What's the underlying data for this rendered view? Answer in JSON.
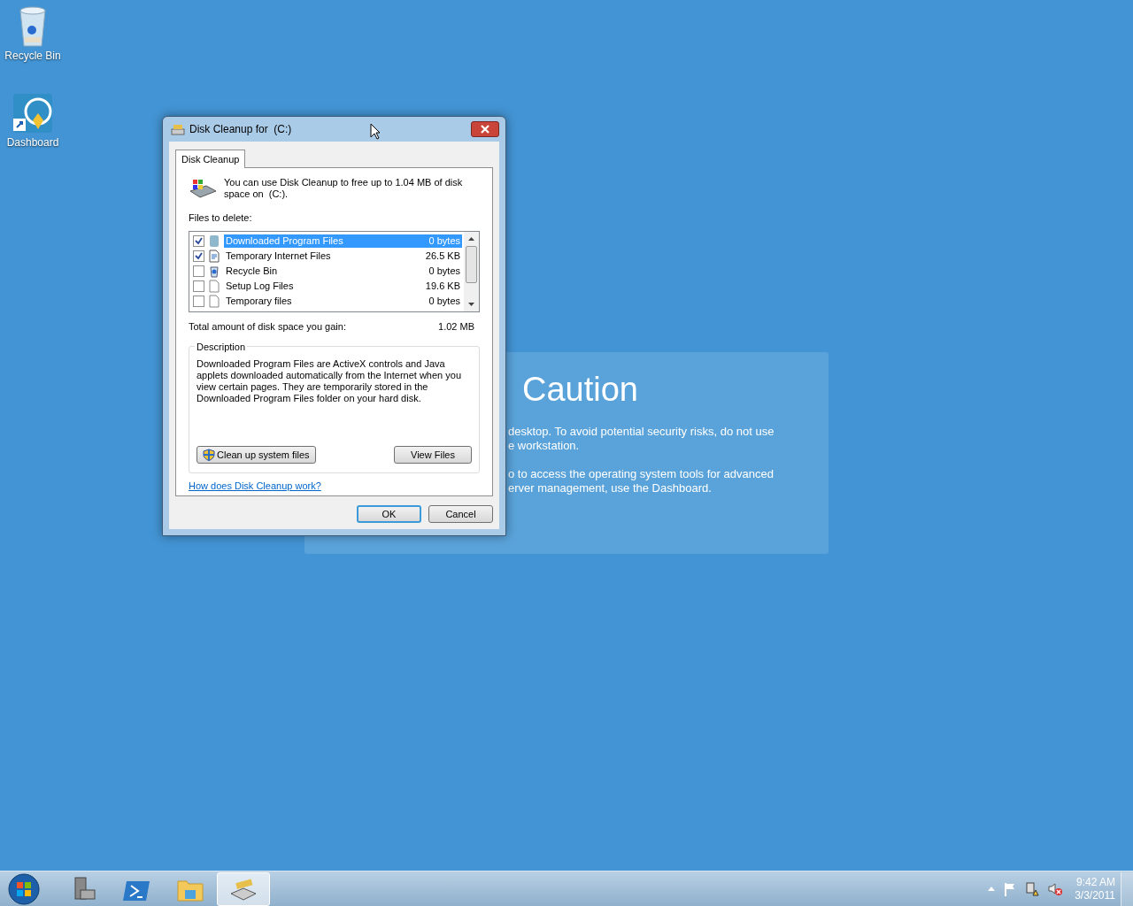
{
  "desktop_icons": [
    {
      "kind": "recycle-bin",
      "label": "Recycle Bin"
    },
    {
      "kind": "dashboard",
      "label": "Dashboard"
    }
  ],
  "caution": {
    "title": "Caution",
    "paragraphs": [
      [
        "desktop. To avoid potential security risks, do not use",
        "e workstation."
      ],
      [
        "o to access the operating system tools for advanced",
        "erver management, use the Dashboard."
      ]
    ]
  },
  "dialog": {
    "title": "Disk Cleanup for  (C:)",
    "tabs": [
      {
        "label": "Disk Cleanup",
        "selected": true
      }
    ],
    "intro": "You can use Disk Cleanup to free up to 1.04 MB of disk space on  (C:).",
    "files_label": "Files to delete:",
    "files": [
      {
        "kind": "program-files",
        "name": "Downloaded Program Files",
        "size": "0 bytes",
        "checked": true,
        "selected": true
      },
      {
        "kind": "internet-files",
        "name": "Temporary Internet Files",
        "size": "26.5 KB",
        "checked": true,
        "selected": false
      },
      {
        "kind": "recycle",
        "name": "Recycle Bin",
        "size": "0 bytes",
        "checked": false,
        "selected": false
      },
      {
        "kind": "document",
        "name": "Setup Log Files",
        "size": "19.6 KB",
        "checked": false,
        "selected": false
      },
      {
        "kind": "document",
        "name": "Temporary files",
        "size": "0 bytes",
        "checked": false,
        "selected": false
      }
    ],
    "total_label": "Total amount of disk space you gain:",
    "total_value": "1.02 MB",
    "description_label": "Description",
    "description": "Downloaded Program Files are ActiveX controls and Java applets downloaded automatically from the Internet when you view certain pages. They are temporarily stored in the Downloaded Program Files folder on your hard disk.",
    "clean_button": "Clean up system files",
    "view_button": "View Files",
    "help_link": "How does Disk Cleanup work?",
    "footer_buttons": [
      {
        "label": "OK",
        "default": true
      },
      {
        "label": "Cancel",
        "default": false
      }
    ]
  },
  "taskbar": {
    "items": [
      {
        "kind": "server-manager",
        "active": false
      },
      {
        "kind": "powershell",
        "active": false
      },
      {
        "kind": "explorer",
        "active": false
      },
      {
        "kind": "disk-cleanup",
        "active": true
      }
    ],
    "clock": {
      "time": "9:42 AM",
      "date": "3/3/2011"
    }
  }
}
